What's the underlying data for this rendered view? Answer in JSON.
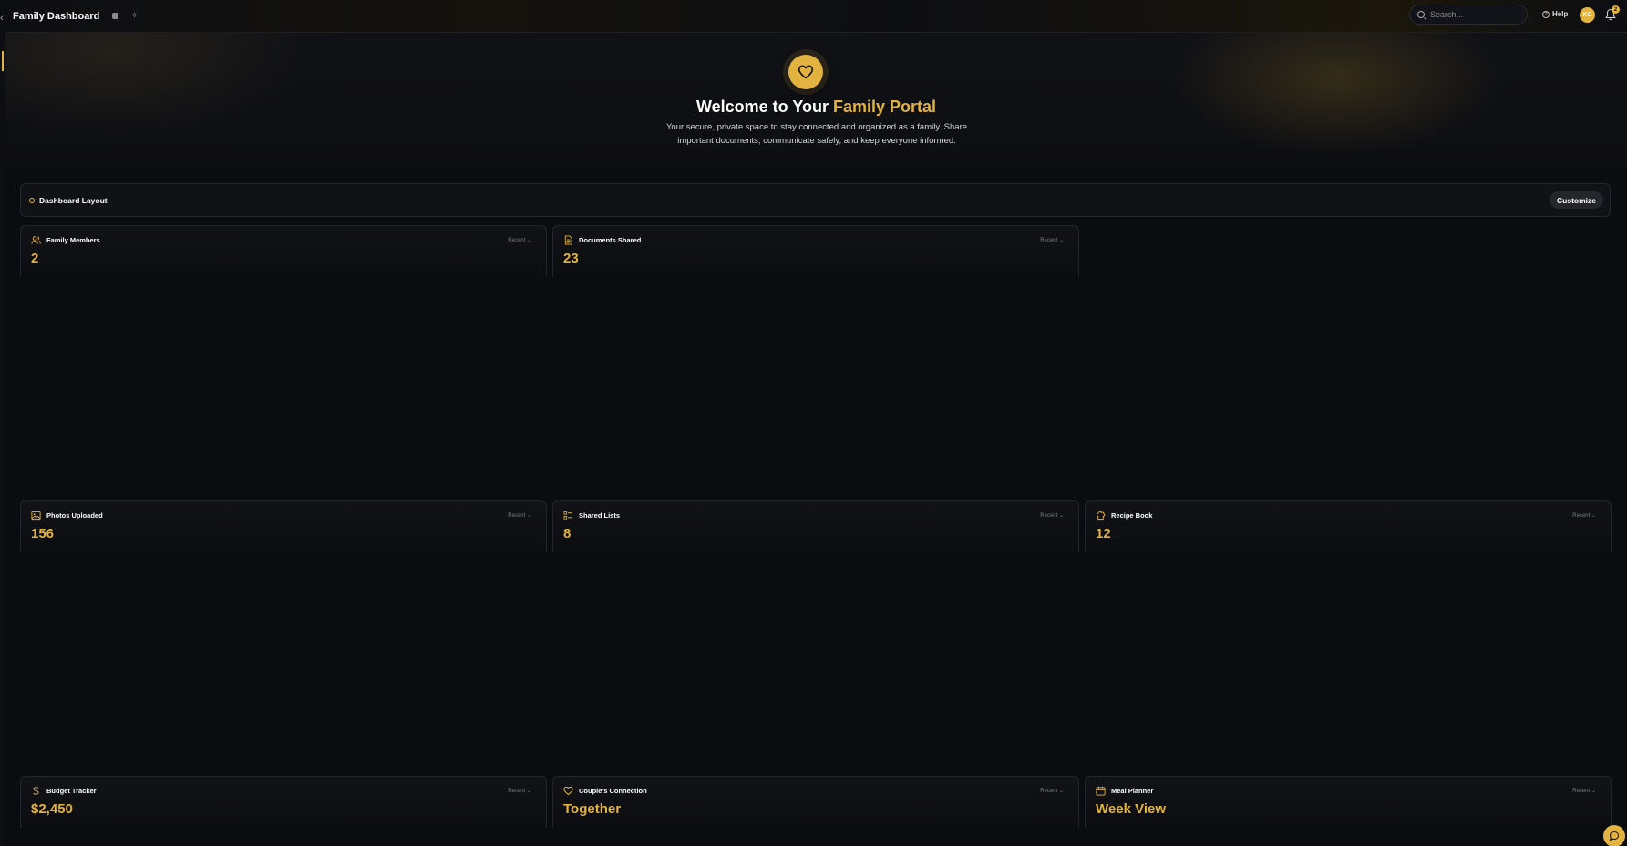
{
  "header": {
    "title": "Family Dashboard",
    "search_placeholder": "Search...",
    "help_label": "Help",
    "avatar_initials": "KC",
    "notification_count": "2"
  },
  "hero": {
    "title_prefix": "Welcome to Your ",
    "title_accent": "Family Portal",
    "subtitle": "Your secure, private space to stay connected and organized as a family. Share important documents, communicate safely, and keep everyone informed."
  },
  "layout_bar": {
    "label": "Dashboard Layout",
    "customize_label": "Customize"
  },
  "cards": [
    {
      "title": "Family Members",
      "value": "2",
      "filter": "Recent",
      "icon": "users-icon"
    },
    {
      "title": "Documents Shared",
      "value": "23",
      "filter": "Recent",
      "icon": "document-icon"
    },
    {
      "title": "Photos Uploaded",
      "value": "156",
      "filter": "Recent",
      "icon": "image-icon"
    },
    {
      "title": "Shared Lists",
      "value": "8",
      "filter": "Recent",
      "icon": "list-icon"
    },
    {
      "title": "Recipe Book",
      "value": "12",
      "filter": "Recent",
      "icon": "chef-hat-icon"
    },
    {
      "title": "Budget Tracker",
      "value": "$2,450",
      "filter": "Recent",
      "icon": "dollar-icon"
    },
    {
      "title": "Couple's Connection",
      "value": "Together",
      "filter": "Recent",
      "icon": "heart-icon"
    },
    {
      "title": "Meal Planner",
      "value": "Week View",
      "filter": "Recent",
      "icon": "calendar-icon"
    }
  ],
  "colors": {
    "accent": "#e3b341",
    "background": "#0b0c10"
  }
}
